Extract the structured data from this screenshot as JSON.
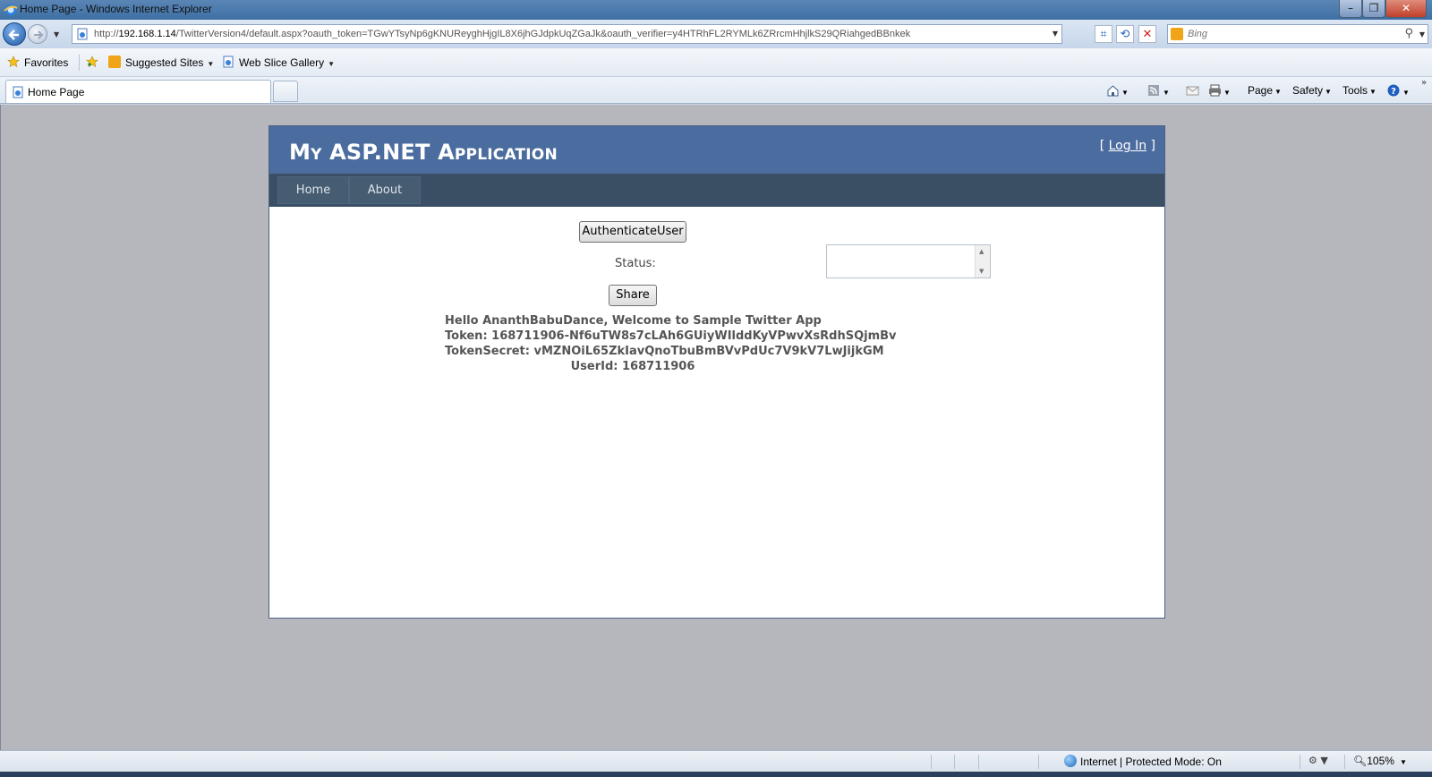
{
  "window": {
    "title": "Home Page - Windows Internet Explorer"
  },
  "addressbar": {
    "url_prefix": "http://",
    "url_host": "192.168.1.14",
    "url_rest": "/TwitterVersion4/default.aspx?oauth_token=TGwYTsyNp6gKNUReyghHjgIL8X6jhGJdpkUqZGaJk&oauth_verifier=y4HTRhFL2RYMLk6ZRrcmHhjlkS29QRiahgedBBnkek",
    "search_placeholder": "Bing"
  },
  "favorites": {
    "favorites_label": "Favorites",
    "suggested_label": "Suggested Sites",
    "webslice_label": "Web Slice Gallery"
  },
  "tabs": {
    "active_label": "Home Page"
  },
  "commandbar": {
    "page_label": "Page",
    "safety_label": "Safety",
    "tools_label": "Tools"
  },
  "site": {
    "app_title": "My ASP.NET Application",
    "login_open": "[",
    "login_link": "Log In",
    "login_close": "]",
    "menu": [
      {
        "label": "Home"
      },
      {
        "label": "About"
      }
    ]
  },
  "main": {
    "authenticate_label": "AuthenticateUser",
    "status_label": "Status:",
    "status_value": "",
    "share_label": "Share",
    "info_lines": [
      "Hello AnanthBabuDance, Welcome to Sample Twitter App",
      "Token: 168711906-Nf6uTW8s7cLAh6GUiyWIlddKyVPwvXsRdhSQjmBv",
      "TokenSecret: vMZNOiL65ZkIavQnoTbuBmBVvPdUc7V9kV7LwJijkGM",
      "UserId: 168711906"
    ]
  },
  "statusbar": {
    "zone_text": "Internet | Protected Mode: On",
    "zoom_text": "105%"
  }
}
